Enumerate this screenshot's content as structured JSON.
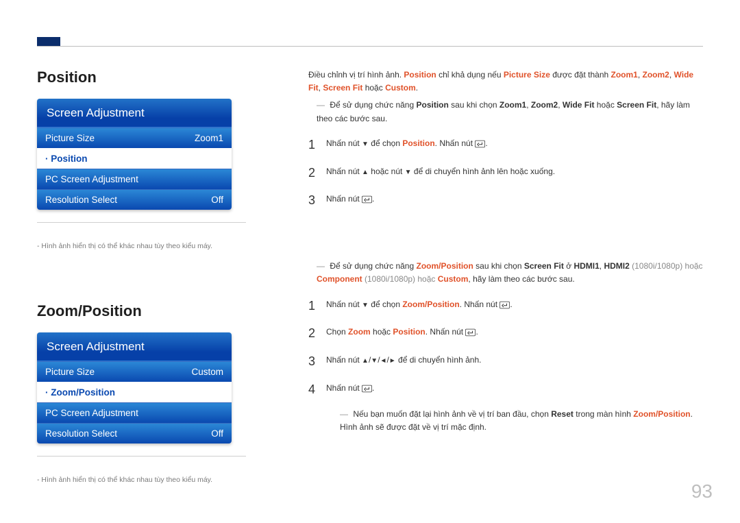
{
  "page_number": "93",
  "section1": {
    "title": "Position",
    "menu": {
      "header": "Screen Adjustment",
      "items": [
        {
          "label": "Picture Size",
          "value": "Zoom1",
          "selected": false
        },
        {
          "label": "· Position",
          "value": "",
          "selected": true
        },
        {
          "label": "PC Screen Adjustment",
          "value": "",
          "selected": false
        },
        {
          "label": "Resolution Select",
          "value": "Off",
          "selected": false
        }
      ]
    },
    "caption": "- Hình ảnh hiển thị có thể khác nhau tùy theo kiểu máy.",
    "text": {
      "intro_pre": "Điều chỉnh vị trí hình ảnh. ",
      "intro_mid1": " chỉ khả dụng nếu ",
      "intro_mid2": " được đặt thành ",
      "intro_or": " hoặc ",
      "intro_dot": ".",
      "position": "Position",
      "picture_size": "Picture Size",
      "zoom1": "Zoom1",
      "zoom2": "Zoom2",
      "widefit": "Wide Fit",
      "screenfit": "Screen Fit",
      "custom": "Custom",
      "dash_pre": "Để sử dụng chức năng ",
      "dash_mid1": " sau khi chọn ",
      "dash_mid2": ", hãy làm theo các bước sau.",
      "comma": ", ",
      "screenfit_bold": "Screen Fit",
      "step1_a": "Nhấn nút ",
      "step1_b": " để chọn ",
      "step1_c": ". Nhấn nút ",
      "step1_d": ".",
      "step2_a": "Nhấn nút ",
      "step2_mid": " hoặc nút ",
      "step2_b": " để di chuyển hình ảnh lên hoặc xuống.",
      "step3": "Nhấn nút "
    }
  },
  "section2": {
    "title": "Zoom/Position",
    "menu": {
      "header": "Screen Adjustment",
      "items": [
        {
          "label": "Picture Size",
          "value": "Custom",
          "selected": false
        },
        {
          "label": "· Zoom/Position",
          "value": "",
          "selected": true
        },
        {
          "label": "PC Screen Adjustment",
          "value": "",
          "selected": false
        },
        {
          "label": "Resolution Select",
          "value": "Off",
          "selected": false
        }
      ]
    },
    "caption": "- Hình ảnh hiển thị có thể khác nhau tùy theo kiểu máy.",
    "text": {
      "dash_pre": "Để sử dụng chức năng ",
      "zp": "Zoom/Position",
      "dash_mid1": " sau khi chọn ",
      "screenfit": "Screen Fit",
      "at": " ở ",
      "hdmi1": "HDMI1",
      "comma": ", ",
      "hdmi2": "HDMI2",
      "res": " (1080i/1080p) hoặc ",
      "component": "Component",
      "res2": " (1080i/1080p) hoặc ",
      "custom": "Custom",
      "dash_tail": ", hãy làm theo các bước sau.",
      "step1_a": "Nhấn nút ",
      "step1_b": " để chọn ",
      "step1_c": ". Nhấn nút ",
      "step1_d": ".",
      "step2_a": "Chọn ",
      "zoom": "Zoom",
      "or": " hoặc ",
      "position": "Position",
      "step2_b": ". Nhấn nút ",
      "step3_a": "Nhấn nút ",
      "step3_b": " để di chuyển hình ảnh.",
      "step4": "Nhấn nút ",
      "tail_dash_a": "Nếu bạn muốn đặt lại hình ảnh về vị trí ban đầu, chọn ",
      "reset": "Reset",
      "tail_dash_b": " trong màn hình ",
      "tail_dash_d": "Hình ảnh sẽ được đặt về vị trí mặc định."
    }
  }
}
